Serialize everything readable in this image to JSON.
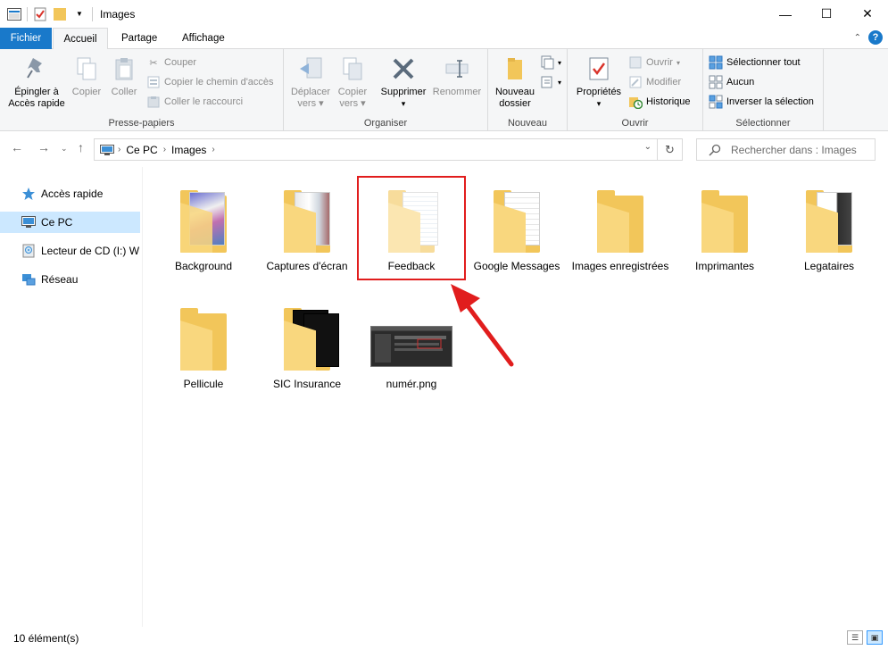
{
  "window": {
    "title": "Images",
    "minimize_glyph": "—",
    "maximize_glyph": "☐",
    "close_glyph": "✕"
  },
  "ribbon_tabs": {
    "file": "Fichier",
    "home": "Accueil",
    "share": "Partage",
    "view": "Affichage",
    "collapse_glyph": "⌃",
    "help_glyph": "?"
  },
  "ribbon": {
    "clipboard": {
      "label": "Presse-papiers",
      "pin_line1": "Épingler à",
      "pin_line2": "Accès rapide",
      "copy": "Copier",
      "paste": "Coller",
      "cut": "Couper",
      "copy_path": "Copier le chemin d'accès",
      "paste_shortcut": "Coller le raccourci"
    },
    "organize": {
      "label": "Organiser",
      "move_line1": "Déplacer",
      "move_line2": "vers",
      "copyto_line1": "Copier",
      "copyto_line2": "vers",
      "delete": "Supprimer",
      "rename": "Renommer"
    },
    "new": {
      "label": "Nouveau",
      "new_folder_line1": "Nouveau",
      "new_folder_line2": "dossier"
    },
    "open": {
      "label": "Ouvrir",
      "properties": "Propriétés",
      "open": "Ouvrir",
      "edit": "Modifier",
      "history": "Historique"
    },
    "select": {
      "label": "Sélectionner",
      "select_all": "Sélectionner tout",
      "select_none": "Aucun",
      "invert": "Inverser la sélection"
    }
  },
  "address": {
    "crumbs": [
      "Ce PC",
      "Images"
    ],
    "search_placeholder": "Rechercher dans : Images"
  },
  "nav_pane": {
    "items": [
      {
        "label": "Accès rapide",
        "icon": "star-icon"
      },
      {
        "label": "Ce PC",
        "icon": "computer-icon",
        "selected": true
      },
      {
        "label": "Lecteur de CD (I:) WD",
        "icon": "cd-drive-icon"
      },
      {
        "label": "Réseau",
        "icon": "network-icon"
      }
    ]
  },
  "items": [
    {
      "label": "Background",
      "type": "folder",
      "preview": "photos"
    },
    {
      "label": "Captures d'écran",
      "type": "folder",
      "preview": "screens"
    },
    {
      "label": "Feedback",
      "type": "folder",
      "preview": "docs",
      "highlighted": true
    },
    {
      "label": "Google Messages",
      "type": "folder",
      "preview": "docs"
    },
    {
      "label": "Images enregistrées",
      "type": "folder",
      "preview": "empty"
    },
    {
      "label": "Imprimantes",
      "type": "folder",
      "preview": "empty"
    },
    {
      "label": "Legataires",
      "type": "folder",
      "preview": "screens"
    },
    {
      "label": "Pellicule",
      "type": "folder",
      "preview": "empty"
    },
    {
      "label": "SIC Insurance",
      "type": "folder",
      "preview": "dark"
    },
    {
      "label": "numér.png",
      "type": "image",
      "preview": "screenshot"
    }
  ],
  "status": {
    "count": "10 élément(s)"
  },
  "colors": {
    "accent": "#1979ca",
    "selection": "#cce8ff",
    "folder": "#f2c65a",
    "annotation_red": "#e11d1d"
  }
}
